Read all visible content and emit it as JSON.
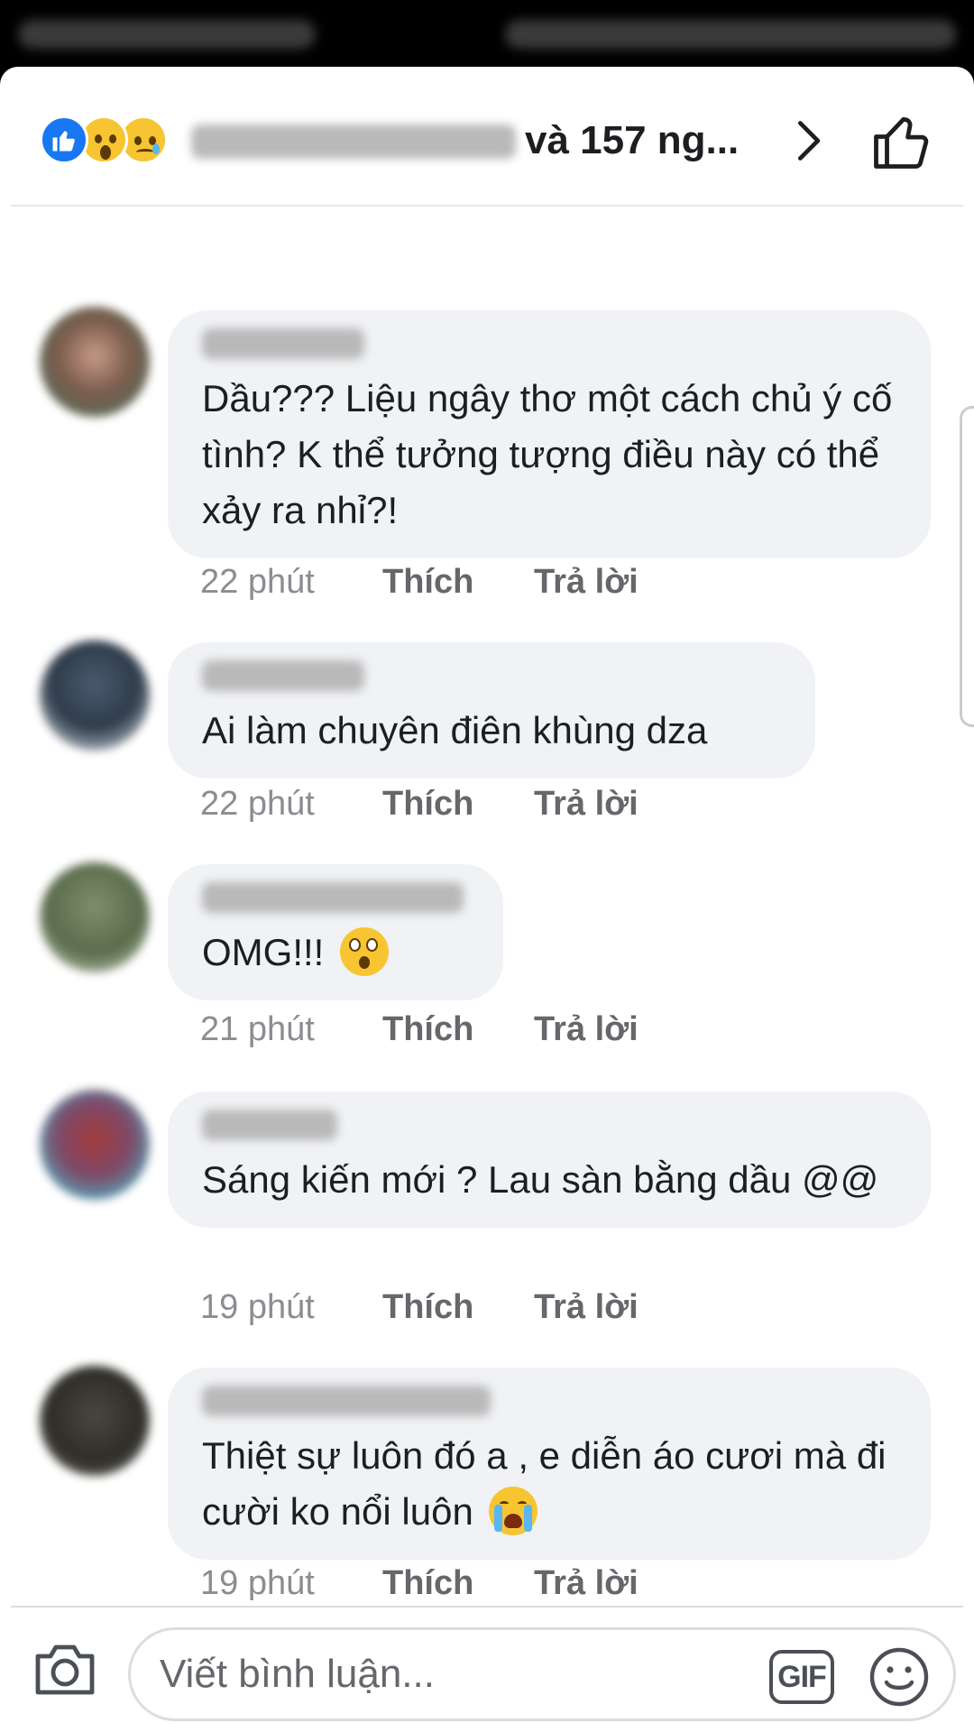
{
  "header": {
    "reactions": [
      "like-icon",
      "wow-icon",
      "sad-icon"
    ],
    "summary": "và 157 ng..."
  },
  "comments": [
    {
      "text": "Dầu??? Liệu ngây thơ một cách chủ ý cố tình? K thể tưởng tượng điều này có thể xảy ra nhỉ?!",
      "time": "22 phút",
      "like": "Thích",
      "reply": "Trả lời"
    },
    {
      "text": "Ai làm chuyên điên khùng dza",
      "time": "22 phút",
      "like": "Thích",
      "reply": "Trả lời"
    },
    {
      "text": "OMG!!!",
      "emoji": "astonished-emoji",
      "time": "21 phút",
      "like": "Thích",
      "reply": "Trả lời"
    },
    {
      "text": "Sáng kiến mới ? Lau sàn bằng dầu @@",
      "time": "19 phút",
      "like": "Thích",
      "reply": "Trả lời"
    },
    {
      "text": "Thiệt sự luôn đó a , e diễn áo cươi mà đi cười ko nổi luôn",
      "emoji": "crying-emoji",
      "time": "19 phút",
      "like": "Thích",
      "reply": "Trả lời"
    }
  ],
  "composer": {
    "placeholder": "Viết bình luận...",
    "gif_label": "GIF"
  },
  "colors": {
    "accent": "#1877f2",
    "bubble": "#f0f2f5",
    "meta": "#8a8d91"
  }
}
